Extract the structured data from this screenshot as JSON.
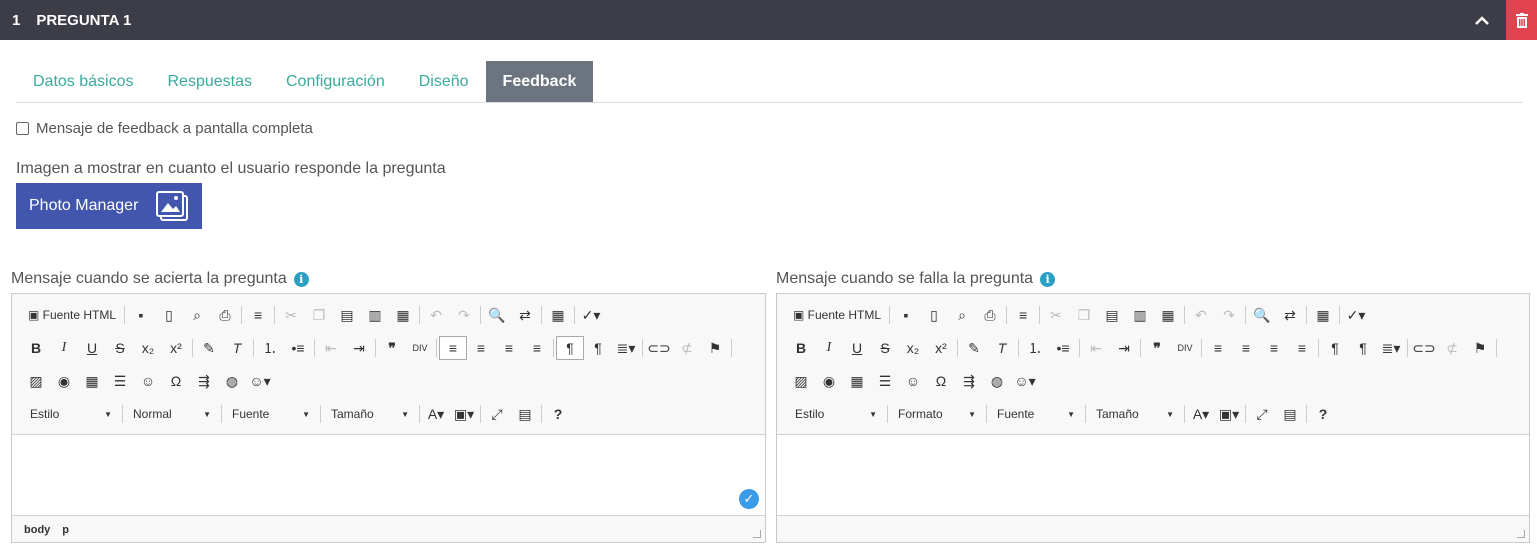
{
  "header": {
    "number": "1",
    "title": "PREGUNTA 1"
  },
  "tabs": [
    "Datos básicos",
    "Respuestas",
    "Configuración",
    "Diseño",
    "Feedback"
  ],
  "fullscreen_label": "Mensaje de feedback a pantalla completa",
  "image_label": "Imagen a mostrar en cuanto el usuario responde la pregunta",
  "photo_button": "Photo Manager",
  "editors": [
    {
      "label": "Mensaje cuando se acierta la pregunta",
      "source": "Fuente HTML",
      "style": "Estilo",
      "format": "Normal",
      "font": "Fuente",
      "size": "Tamaño",
      "path": [
        "body",
        "p"
      ]
    },
    {
      "label": "Mensaje cuando se falla la pregunta",
      "source": "Fuente HTML",
      "style": "Estilo",
      "format": "Formato",
      "font": "Fuente",
      "size": "Tamaño",
      "path": []
    }
  ],
  "colors": {
    "header_bg": "#3c3d46",
    "delete_bg": "#e04250",
    "tab_active_bg": "#6c757f",
    "tab_text": "#3aaa9e",
    "photo_btn_bg": "#4156ac",
    "info_icon": "#2a9fc2"
  }
}
